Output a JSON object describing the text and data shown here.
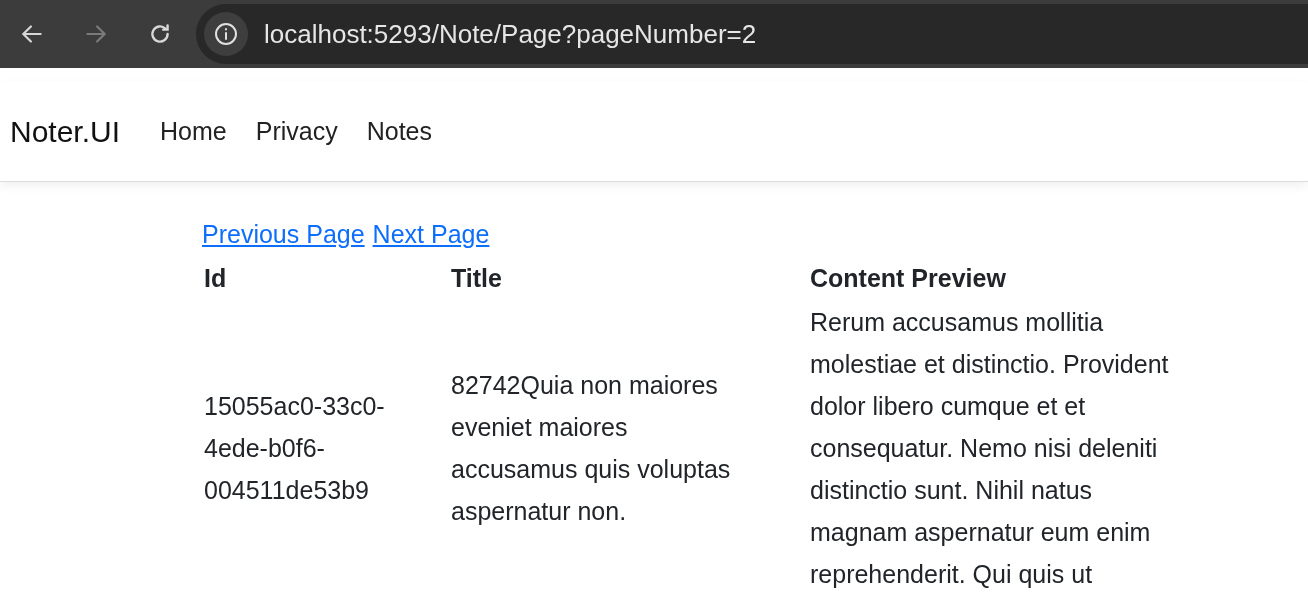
{
  "browser": {
    "back": {
      "disabled": false
    },
    "forward": {
      "disabled": true
    },
    "url": "localhost:5293/Note/Page?pageNumber=2"
  },
  "navbar": {
    "brand": "Noter.UI",
    "links": [
      "Home",
      "Privacy",
      "Notes"
    ]
  },
  "pager": [
    "Previous Page",
    "Next Page"
  ],
  "table": {
    "columns": [
      "Id",
      "Title",
      "Content Preview"
    ],
    "rows": [
      {
        "cells": [
          "15055ac0-33c0-4ede-b0f6-004511de53b9",
          "82742Quia non maiores eveniet maiores accusamus quis voluptas aspernatur non.",
          "Rerum accusamus mollitia molestiae et distinctio. Provident dolor libero cumque et et consequatur. Nemo nisi deleniti distinctio sunt. Nihil natus magnam aspernatur eum enim reprehenderit. Qui quis ut"
        ]
      }
    ]
  }
}
